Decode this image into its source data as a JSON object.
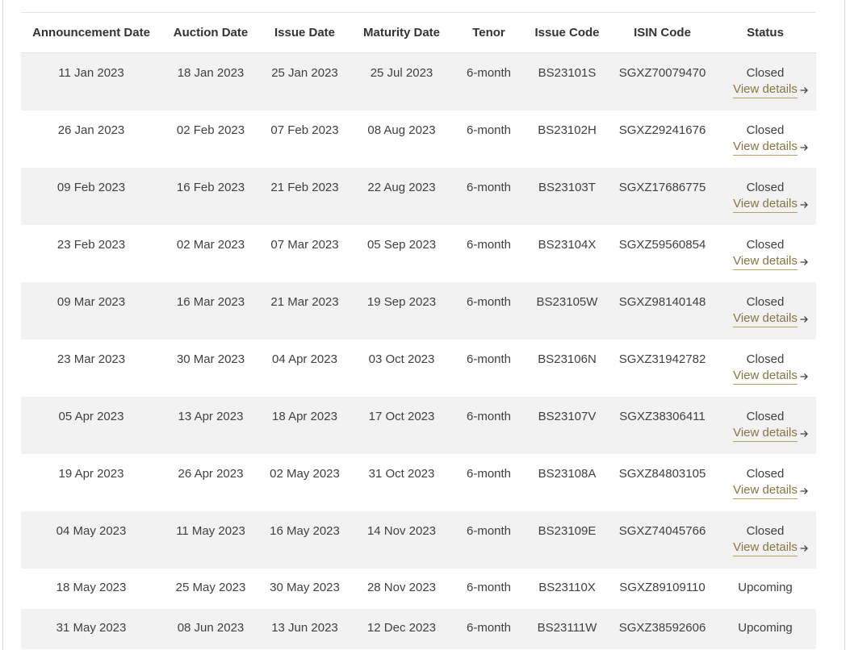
{
  "table": {
    "headers": {
      "announcement": "Announcement Date",
      "auction": "Auction Date",
      "issue": "Issue Date",
      "maturity": "Maturity Date",
      "tenor": "Tenor",
      "issue_code": "Issue Code",
      "isin": "ISIN Code",
      "status": "Status"
    },
    "details_label": "View details",
    "rows": [
      {
        "announcement": "11 Jan 2023",
        "auction": "18 Jan 2023",
        "issue": "25 Jan 2023",
        "maturity": "25 Jul 2023",
        "tenor": "6-month",
        "issue_code": "BS23101S",
        "isin": "SGXZ70079470",
        "status": "Closed",
        "has_details": true
      },
      {
        "announcement": "26 Jan 2023",
        "auction": "02 Feb 2023",
        "issue": "07 Feb 2023",
        "maturity": "08 Aug 2023",
        "tenor": "6-month",
        "issue_code": "BS23102H",
        "isin": "SGXZ29241676",
        "status": "Closed",
        "has_details": true
      },
      {
        "announcement": "09 Feb 2023",
        "auction": "16 Feb 2023",
        "issue": "21 Feb 2023",
        "maturity": "22 Aug 2023",
        "tenor": "6-month",
        "issue_code": "BS23103T",
        "isin": "SGXZ17686775",
        "status": "Closed",
        "has_details": true
      },
      {
        "announcement": "23 Feb 2023",
        "auction": "02 Mar 2023",
        "issue": "07 Mar 2023",
        "maturity": "05 Sep 2023",
        "tenor": "6-month",
        "issue_code": "BS23104X",
        "isin": "SGXZ59560854",
        "status": "Closed",
        "has_details": true
      },
      {
        "announcement": "09 Mar 2023",
        "auction": "16 Mar 2023",
        "issue": "21 Mar 2023",
        "maturity": "19 Sep 2023",
        "tenor": "6-month",
        "issue_code": "BS23105W",
        "isin": "SGXZ98140148",
        "status": "Closed",
        "has_details": true
      },
      {
        "announcement": "23 Mar 2023",
        "auction": "30 Mar 2023",
        "issue": "04 Apr 2023",
        "maturity": "03 Oct 2023",
        "tenor": "6-month",
        "issue_code": "BS23106N",
        "isin": "SGXZ31942782",
        "status": "Closed",
        "has_details": true
      },
      {
        "announcement": "05 Apr 2023",
        "auction": "13 Apr 2023",
        "issue": "18 Apr 2023",
        "maturity": "17 Oct 2023",
        "tenor": "6-month",
        "issue_code": "BS23107V",
        "isin": "SGXZ38306411",
        "status": "Closed",
        "has_details": true
      },
      {
        "announcement": "19 Apr 2023",
        "auction": "26 Apr 2023",
        "issue": "02 May 2023",
        "maturity": "31 Oct 2023",
        "tenor": "6-month",
        "issue_code": "BS23108A",
        "isin": "SGXZ84803105",
        "status": "Closed",
        "has_details": true
      },
      {
        "announcement": "04 May 2023",
        "auction": "11 May 2023",
        "issue": "16 May 2023",
        "maturity": "14 Nov 2023",
        "tenor": "6-month",
        "issue_code": "BS23109E",
        "isin": "SGXZ74045766",
        "status": "Closed",
        "has_details": true
      },
      {
        "announcement": "18 May 2023",
        "auction": "25 May 2023",
        "issue": "30 May 2023",
        "maturity": "28 Nov 2023",
        "tenor": "6-month",
        "issue_code": "BS23110X",
        "isin": "SGXZ89109110",
        "status": "Upcoming",
        "has_details": false
      },
      {
        "announcement": "31 May 2023",
        "auction": "08 Jun 2023",
        "issue": "13 Jun 2023",
        "maturity": "12 Dec 2023",
        "tenor": "6-month",
        "issue_code": "BS23111W",
        "isin": "SGXZ38592606",
        "status": "Upcoming",
        "has_details": false
      }
    ]
  },
  "colors": {
    "link": "#8a7442",
    "row_shade": "#f2f2f2"
  },
  "icons": {
    "details": "arrow-right-icon"
  }
}
